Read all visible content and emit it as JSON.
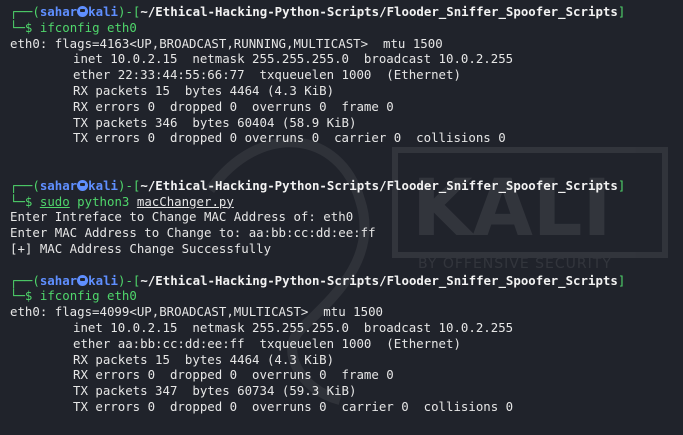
{
  "prompt": {
    "open": "┌──(",
    "user": "sahar",
    "host": "kali",
    "mid": ")-[",
    "path": "~/Ethical-Hacking-Python-Scripts/Flooder_Sniffer_Spoofer_Scripts",
    "close": "]",
    "arrow": "└─$"
  },
  "watermark": {
    "logo_text": "KALI",
    "tagline": "BY OFFENSIVE SECURITY"
  },
  "block1": {
    "command": "ifconfig eth0",
    "lines": [
      "eth0: flags=4163<UP,BROADCAST,RUNNING,MULTICAST>  mtu 1500",
      "inet 10.0.2.15  netmask 255.255.255.0  broadcast 10.0.2.255",
      "ether 22:33:44:55:66:77  txqueuelen 1000  (Ethernet)",
      "RX packets 15  bytes 4464 (4.3 KiB)",
      "RX errors 0  dropped 0  overruns 0  frame 0",
      "TX packets 346  bytes 60404 (58.9 KiB)",
      "TX errors 0  dropped 0 overruns 0  carrier 0  collisions 0"
    ]
  },
  "block2": {
    "cmd_sudo": "sudo",
    "cmd_prog": "python3",
    "cmd_file": "macChanger.py",
    "lines": [
      "Enter Intreface to Change MAC Address of: eth0",
      "Enter MAC Address to Change to: aa:bb:cc:dd:ee:ff",
      "[+] MAC Address Change Successfully"
    ]
  },
  "block3": {
    "command": "ifconfig eth0",
    "lines": [
      "eth0: flags=4099<UP,BROADCAST,MULTICAST>  mtu 1500",
      "inet 10.0.2.15  netmask 255.255.255.0  broadcast 10.0.2.255",
      "ether aa:bb:cc:dd:ee:ff  txqueuelen 1000  (Ethernet)",
      "RX packets 15  bytes 4464 (4.3 KiB)",
      "RX errors 0  dropped 0  overruns 0  frame 0",
      "TX packets 347  bytes 60734 (59.3 KiB)",
      "TX errors 0  dropped 0  overruns 0  carrier 0  collisions 0"
    ]
  },
  "colors": {
    "background": "#20232b",
    "prompt_blue": "#5f8fff",
    "command_green": "#4fd66b"
  }
}
